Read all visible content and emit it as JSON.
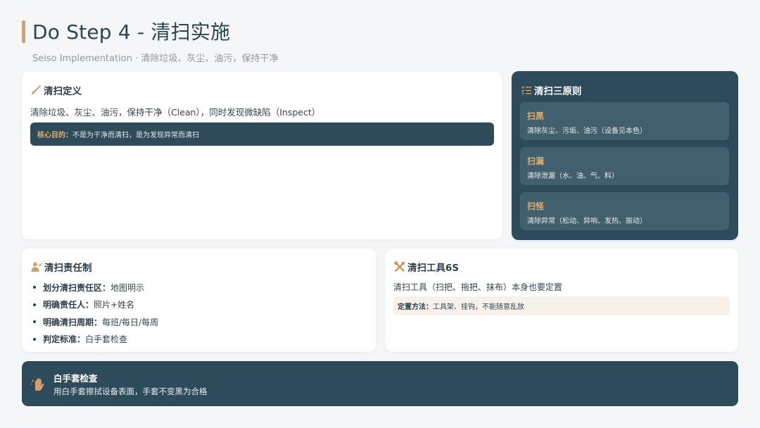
{
  "header": {
    "title": "Do Step 4 - 清扫实施",
    "subtitle": "Seiso Implementation · 清除垃圾、灰尘、油污，保持干净"
  },
  "definition": {
    "icon": "broom-icon",
    "title": "清扫定义",
    "description": "清除垃圾、灰尘、油污，保持干净（Clean），同时发现微缺陷（Inspect）",
    "core_label": "核心目的：",
    "core_text": "不是为干净而清扫，是为发现异常而清扫"
  },
  "principles": {
    "icon": "list-check-icon",
    "title": "清扫三原则",
    "items": [
      {
        "heading": "扫黑",
        "text": "清除灰尘、污垢、油污（设备见本色）"
      },
      {
        "heading": "扫漏",
        "text": "清除泄漏（水、油、气、料）"
      },
      {
        "heading": "扫怪",
        "text": "清除异常（松动、异响、发热、振动）"
      }
    ]
  },
  "responsibility": {
    "icon": "user-check-icon",
    "title": "清扫责任制",
    "items": [
      {
        "key": "划分清扫责任区：",
        "value": "地图明示"
      },
      {
        "key": "明确责任人：",
        "value": "照片+姓名"
      },
      {
        "key": "明确清扫周期：",
        "value": "每班/每日/每周"
      },
      {
        "key": "判定标准：",
        "value": "白手套检查"
      }
    ]
  },
  "tools": {
    "icon": "tools-icon",
    "title": "清扫工具6S",
    "description": "清扫工具（扫把、拖把、抹布）本身也要定置",
    "method_label": "定置方法：",
    "method_text": "工具架、挂钩，不能随意乱放"
  },
  "glove_check": {
    "icon": "hands-sparkle-icon",
    "title": "白手套检查",
    "text": "用白手套擦拭设备表面，手套不变黑为合格"
  },
  "colors": {
    "accent_gold": "#d2a06b",
    "dark_teal": "#2e4b5b",
    "panel_teal": "#425f6d",
    "background": "#f4f6f7"
  }
}
